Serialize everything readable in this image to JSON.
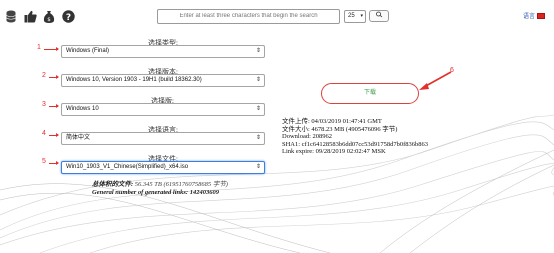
{
  "top": {
    "icons": [
      "database-icon",
      "thumbs-up-icon",
      "donate-bag-icon",
      "help-icon"
    ],
    "search_placeholder": "Enter at least three characters that begin the search",
    "results_count": "25",
    "language_label": "语言"
  },
  "form": {
    "type": {
      "label": "选择类型:",
      "value": "Windows (Final)",
      "number": "1"
    },
    "version": {
      "label": "选择版本:",
      "value": "Windows 10, Version 1903 - 19H1 (build 18362.30)",
      "number": "2"
    },
    "edition": {
      "label": "选择版:",
      "value": "Windows 10",
      "number": "3"
    },
    "language": {
      "label": "选择语言:",
      "value": "简体中文",
      "number": "4"
    },
    "file": {
      "label": "选择文件:",
      "value": "Win10_1903_V1_Chinese(Simplified)_x64.iso",
      "number": "5"
    }
  },
  "totals": {
    "size_label": "总体积的文件:",
    "size_value": "56.345 TB",
    "size_bytes": "(61951760758685 字节)",
    "links_label": "General number of generated links:",
    "links_value": "142403609"
  },
  "download": {
    "label": "下载",
    "number": "6"
  },
  "fileinfo": {
    "uploaded": "文件上传: 04/03/2019 01:47:41 GMT",
    "size": "文件大小: 4678.23 MB (4905476096 字节)",
    "download": "Download: 208962",
    "sha1": "SHA1: cf1c64128583b6dd07cc53d91758d7b0f836b863",
    "expire": "Link expire: 09/28/2019 02:02:47 MSK"
  },
  "colors": {
    "accent_red": "#e2302b",
    "download_green": "#3b9e4a",
    "focus_blue": "#3f7fd9"
  }
}
